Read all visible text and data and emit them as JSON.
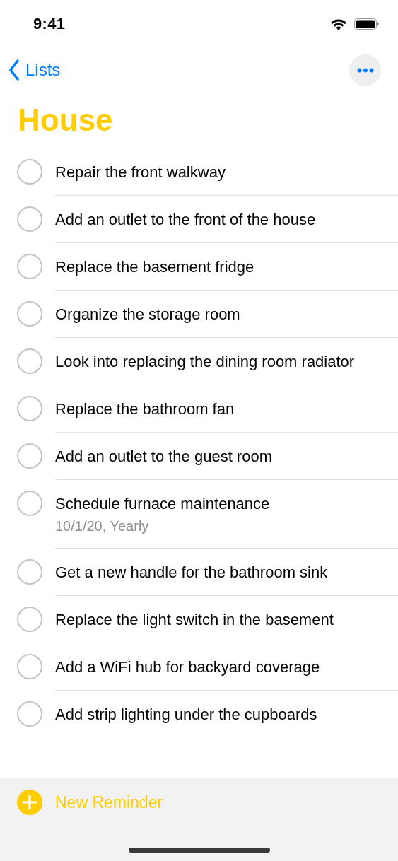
{
  "status_bar": {
    "time": "9:41"
  },
  "nav": {
    "back_label": "Lists"
  },
  "list": {
    "title": "House"
  },
  "reminders": [
    {
      "title": "Repair the front walkway",
      "completed": false
    },
    {
      "title": "Add an outlet to the front of the house",
      "completed": false
    },
    {
      "title": "Replace the basement fridge",
      "completed": false
    },
    {
      "title": "Organize the storage room",
      "completed": false
    },
    {
      "title": "Look into replacing the dining room radiator",
      "completed": false
    },
    {
      "title": "Replace the bathroom fan",
      "completed": false
    },
    {
      "title": "Add an outlet to the guest room",
      "completed": false
    },
    {
      "title": "Schedule furnace maintenance",
      "detail": "10/1/20, Yearly",
      "completed": false
    },
    {
      "title": "Get a new handle for the bathroom sink",
      "completed": false
    },
    {
      "title": "Replace the light switch in the basement",
      "completed": false
    },
    {
      "title": "Add a WiFi hub for backyard coverage",
      "completed": false
    },
    {
      "title": "Add strip lighting under the cupboards",
      "completed": false
    }
  ],
  "toolbar": {
    "new_label": "New Reminder"
  }
}
